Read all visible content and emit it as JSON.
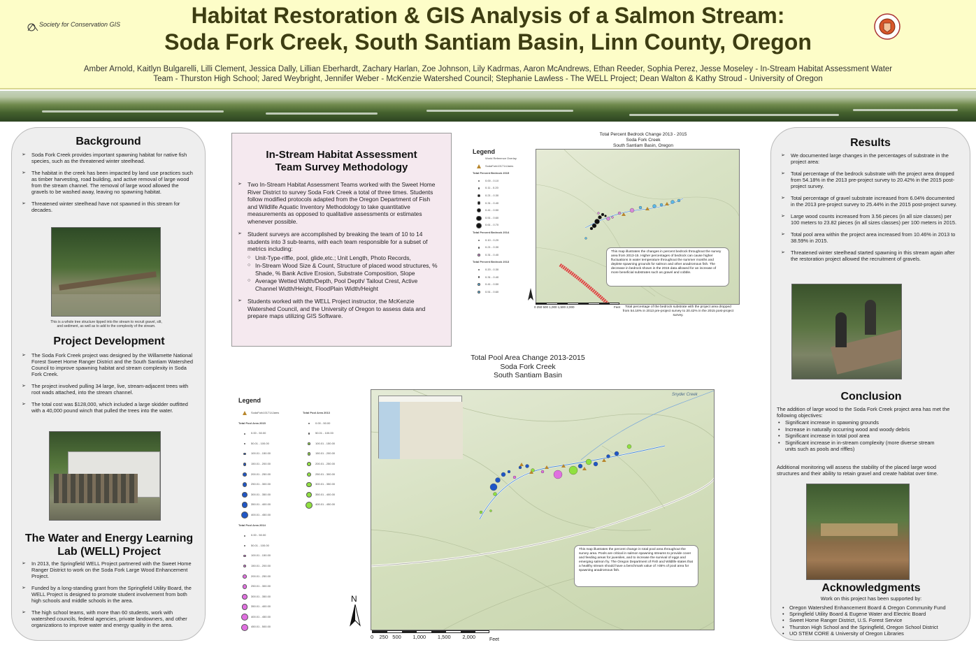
{
  "header": {
    "title_line1": "Habitat Restoration & GIS Analysis of a Salmon Stream:",
    "title_line2": "Soda Fork Creek, South Santiam Basin, Linn County, Oregon",
    "authors": "Amber Arnold, Kaitlyn Bulgarelli, Lilli Clement, Jessica Dally, Lillian Eberhardt, Zachary Harlan, Zoe Johnson, Lily Kadrmas, Aaron McAndrews, Ethan Reeder, Sophia Perez, Jesse Moseley - In-Stream Habitat Assessment Water Team - Thurston High School;  Jared Weybright, Jennifer Weber - McKenzie Watershed Council; Stephanie Lawless - The WELL Project; Dean Walton & Kathy Stroud - University of Oregon",
    "logo_left": "Society for Conservation GIS",
    "logo_right": "seal-icon"
  },
  "background": {
    "heading": "Background",
    "bullets": [
      "Soda Fork Creek provides important spawning habitat for native fish species, such as the threatened winter steelhead.",
      "The habitat in the creek has been impacted by land use practices such as timber harvesting, road building, and active removal of large wood from the stream channel.  The removal of large wood allowed the gravels to be washed away, leaving no spawning habitat.",
      "Threatened winter steelhead have not spawned in this stream for decades."
    ],
    "photo_caption": "This is a whole tree structure tipped into the stream to recruit gravel, silt, and sediment, as well as to add to the  complexity of the stream."
  },
  "project": {
    "heading": "Project Development",
    "bullets": [
      "The Soda Fork Creek project was designed by the Willamette National Forest Sweet Home Ranger District and the South Santiam Watershed Council to improve spawning habitat and stream complexity in Soda Fork Creek.",
      "The project involved pulling 34 large, live, stream-adjacent trees with root wads attached, into the stream channel.",
      "The total cost was $128,000, which included a large skidder outfitted with a 40,000 pound winch that pulled the trees into the water."
    ]
  },
  "well": {
    "heading_line1": "The Water and Energy Learning",
    "heading_line2": "Lab (WELL) Project",
    "bullets": [
      "In 2013, the Springfield WELL Project partnered with the Sweet Home Ranger District to work on the Soda Fork Large Wood Enhancement Project.",
      "Funded by a long-standing grant from the Springfield Utility Board, the WELL Project is designed to promote student involvement from both high schools and middle schools in the area.",
      "The high school teams, with more than 60 students, work with watershed councils, federal agencies, private landowners, and other organizations to improve water and energy quality in the area."
    ]
  },
  "method": {
    "heading_line1": "In-Stream Habitat Assessment",
    "heading_line2": "Team Survey Methodology",
    "b1": "Two In-Stream Habitat Assessment Teams worked with the Sweet Home River District to survey Soda Fork Creek a total of three times. Students follow modified protocols adapted from the Oregon Department of Fish and Wildlife Aquatic Inventory Methodology to take quantitative measurements as opposed to qualitative assessments or estimates whenever possible.",
    "b2": "Student surveys are accomplished by breaking the team of 10 to 14 students into 3 sub-teams, with each team responsible for a subset of metrics including:",
    "b2_sub": [
      "Unit-Type-riffle, pool, glide,etc.; Unit Length, Photo Records,",
      "In-Stream Wood Size & Count, Structure of placed wood structures, % Shade, % Bank Active Erosion, Substrate Composition, Slope",
      "Average Wetted Width/Depth, Pool Depth/ Tailout Crest, Active Channel Width/Height, FloodPlain Width/Height"
    ],
    "b3": "Students worked with the WELL Project instructor, the McKenzie Watershed Council, and the University of Oregon to assess data and prepare maps utilizing GIS Software."
  },
  "bedrock_map": {
    "title_l1": "Total Percent Bedrock Change 2013 - 2015",
    "title_l2": "Soda Fork Creek",
    "title_l3": "South Santiam Basin, Oregon",
    "legend_title": "Legend",
    "legend_items": [
      "World Reference Overlay",
      "SodaFork101714Jams",
      "Total Percent Bedrock 2015",
      "0.00 - 0.10",
      "0.11 - 0.20",
      "0.21 - 0.30",
      "0.31 - 0.40",
      "0.41 - 0.50",
      "0.51 - 0.60",
      "0.61 - 0.70",
      "Total Percent Bedrock 2014",
      "0.10 - 0.20",
      "0.21 - 0.30",
      "0.31 - 0.40",
      "Total Percent Bedrock 2013",
      "0.20 - 0.30",
      "0.31 - 0.40",
      "0.41 - 0.50",
      "0.51 - 0.60"
    ],
    "note": "This map illustrates the changes in percent bedrock throughout the survey area from 2013-15. Higher percentages of bedrock can cause higher fluctuations in water temperature throughout the summer months and deplete spawning grounds for salmon and other anadromous fish. The decrease in bedrock shown in the 2015 data allowed for an increase of more beneficial substrates such as gravel and cobble.",
    "scale": "0  250  500      1,000     1,500     2,000",
    "scale_unit": "Feet",
    "caption": "Total percentage of the bedrock substrate with the project area dropped from 54.18% in 2013 pre-project survey to 20.42% in the 2015 post-project survey."
  },
  "pool_map": {
    "title_l1": "Total Pool Area Change 2013-2015",
    "title_l2": "Soda Fork Creek",
    "title_l3": "South Santiam Basin",
    "legend_title": "Legend",
    "legend_col1": [
      "SodaFork101714Jams",
      "Total Pool Area 2015",
      "0.00 - 50.00",
      "50.01 - 100.00",
      "100.01 - 150.00",
      "150.01 - 200.00",
      "200.01 - 250.00",
      "250.01 - 300.00",
      "300.01 - 350.00",
      "350.01 - 400.00",
      "400.01 - 450.00",
      "Total Pool Area 2014",
      "0.00 - 50.00",
      "50.01 - 100.00",
      "100.01 - 150.00",
      "150.01 - 200.00",
      "200.01 - 250.00",
      "250.01 - 300.00",
      "300.01 - 350.00",
      "350.01 - 400.00",
      "400.01 - 450.00",
      "450.01 - 500.00"
    ],
    "legend_col2": [
      "Total Pool Area 2013",
      "0.00 - 50.00",
      "50.01 - 100.00",
      "100.01 - 150.00",
      "150.01 - 200.00",
      "200.01 - 250.00",
      "250.01 - 300.00",
      "300.01 - 350.00",
      "350.01 - 400.00",
      "400.01 - 450.00"
    ],
    "note": "This map illustrates the percent change in total pool area throughout the survey area. Pools are critical in salmon spawning streams to provide cover and feeding areas for juveniles, and to increase the survival of eggs and emerging salmon fry. The Oregon Department of Fish and Wildlife states that a healthy stream should have a benchmark value of >35% of pool area for spawning anadromous fish.",
    "place_label": "Snyder Creek",
    "scale": "0    250   500        1,000        1,500        2,000",
    "scale_unit": "Feet",
    "north": "N"
  },
  "results": {
    "heading": "Results",
    "bullets": [
      "We documented large changes in the percentages of substrate in the project area:",
      "Total percentage of the bedrock substrate with the project area dropped from 54.18% in the 2013 pre-project survey to 20.42% in the 2015 post-project survey.",
      "Total percentage of gravel substrate increased from 6.04% documented in the 2013 pre-project survey to 25.44% in the 2015 post-project survey.",
      "Large wood counts increased from 3.56 pieces (in all size classes) per 100 meters to 23.82 pieces (in all sizes classes) per 100 meters in 2015.",
      "Total pool area within the project area increased from 10.46% in 2013 to 38.59% in 2015.",
      "Threatened winter steelhead started spawning in this stream again after the restoration project allowed the recruitment of gravels."
    ]
  },
  "conclusion": {
    "heading": "Conclusion",
    "intro": "The addition of large wood to the Soda Fork Creek project area has met the following objectives:",
    "items": [
      "Significant increase in spawning grounds",
      "Increase in naturally occurring wood and woody debris",
      "Significant increase in total pool area",
      "Significant increase in in-stream complexity (more diverse stream units such as pools and riffles)"
    ],
    "outro": "Additional monitoring will assess the stability of the placed large wood structures and their ability to retain gravel and create habitat over time."
  },
  "ack": {
    "heading": "Acknowledgments",
    "intro": "Work on this project has been supported by:",
    "items": [
      "Oregon Watershed Enhancement Board & Oregon Community Fund",
      "Springfield Utility Board & Eugene Water and Electric Board",
      "Sweet Home Ranger District, U.S. Forest Service",
      "Thurston High School and the Springfield, Oregon School District",
      "UO STEM CORE & University of Oregon Libraries"
    ]
  }
}
